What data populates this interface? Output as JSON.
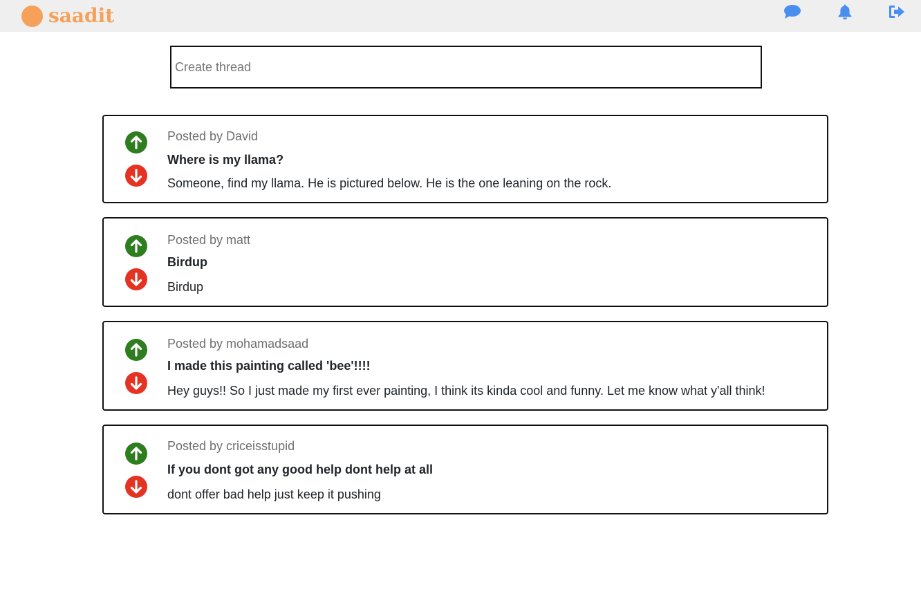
{
  "app": {
    "brand_name": "saadit",
    "brand_color": "#f6a15a"
  },
  "nav": {
    "icons": [
      "chat-icon",
      "bell-icon",
      "logout-icon"
    ],
    "icon_color": "#4a8ef0"
  },
  "create_thread": {
    "placeholder": "Create thread",
    "value": ""
  },
  "colors": {
    "upvote": "#2e7d1f",
    "downvote": "#e53323"
  },
  "posts": [
    {
      "author": "Posted by David",
      "title": "Where is my llama?",
      "body": "Someone, find my llama. He is pictured below. He is the one leaning on the rock."
    },
    {
      "author": "Posted by matt",
      "title": "Birdup",
      "body": "Birdup"
    },
    {
      "author": "Posted by mohamadsaad",
      "title": "I made this painting called 'bee'!!!!",
      "body": "Hey guys!! So I just made my first ever painting, I think its kinda cool and funny. Let me know what y'all think!"
    },
    {
      "author": "Posted by criceisstupid",
      "title": "If you dont got any good help dont help at all",
      "body": "dont offer bad help just keep it pushing"
    }
  ]
}
